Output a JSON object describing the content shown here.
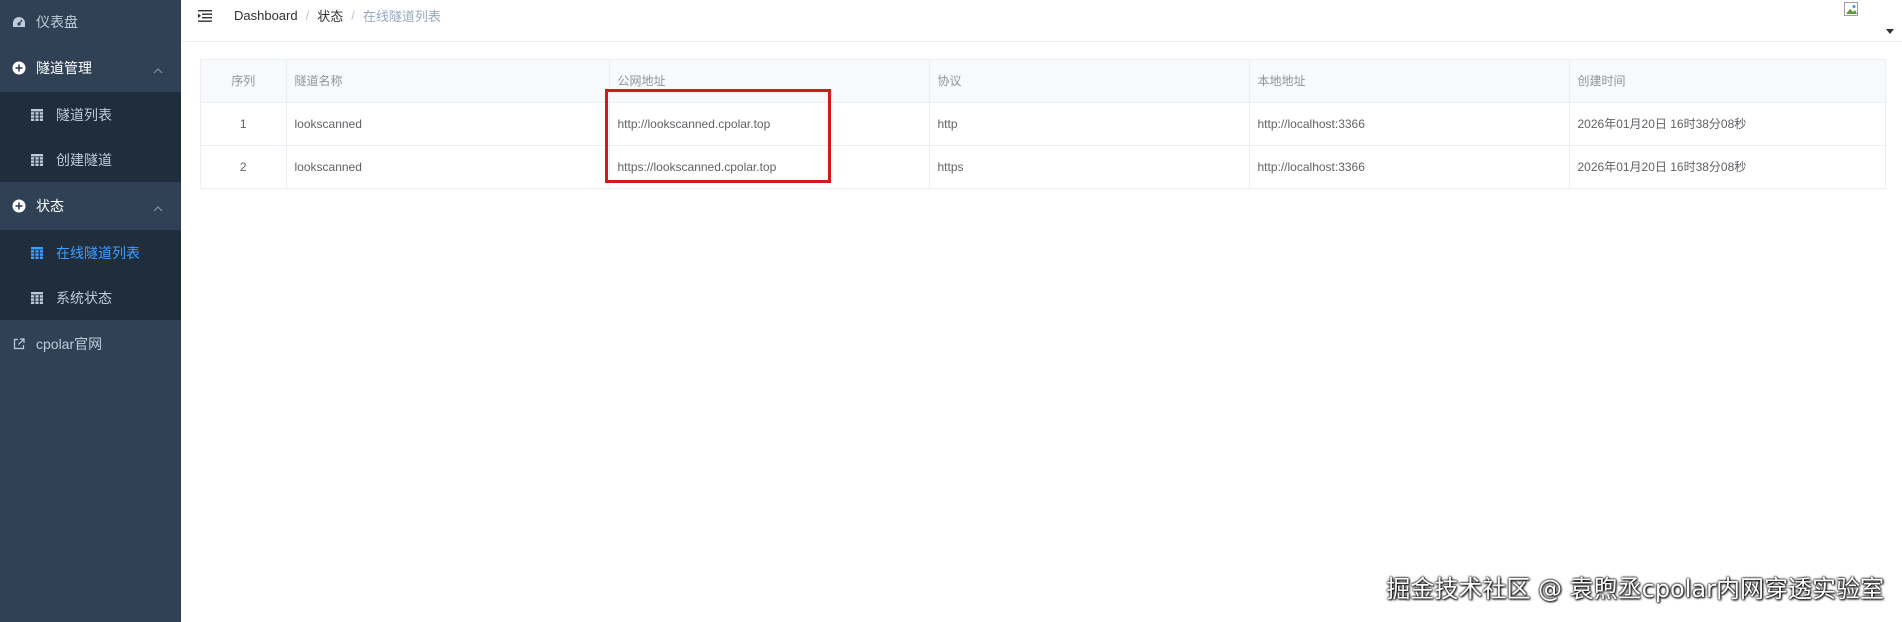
{
  "sidebar": {
    "dashboard": {
      "label": "仪表盘",
      "icon": "dashboard-icon"
    },
    "tunnel_mgmt": {
      "label": "隧道管理",
      "icon": "plus-circle-icon",
      "items": [
        {
          "label": "隧道列表",
          "icon": "table-icon"
        },
        {
          "label": "创建隧道",
          "icon": "table-icon"
        }
      ]
    },
    "status": {
      "label": "状态",
      "icon": "plus-circle-icon",
      "items": [
        {
          "label": "在线隧道列表",
          "icon": "table-icon",
          "active": true
        },
        {
          "label": "系统状态",
          "icon": "table-icon"
        }
      ]
    },
    "website": {
      "label": "cpolar官网",
      "icon": "external-link-icon"
    }
  },
  "breadcrumb": [
    "Dashboard",
    "状态",
    "在线隧道列表"
  ],
  "table": {
    "columns": [
      "序列",
      "隧道名称",
      "公网地址",
      "协议",
      "本地地址",
      "创建时间"
    ],
    "rows": [
      [
        "1",
        "lookscanned",
        "http://lookscanned.cpolar.top",
        "http",
        "http://localhost:3366",
        "2026年01月20日 16时38分08秒"
      ],
      [
        "2",
        "lookscanned",
        "https://lookscanned.cpolar.top",
        "https",
        "http://localhost:3366",
        "2026年01月20日 16时38分08秒"
      ]
    ]
  },
  "watermark": "掘金技术社区 @ 袁煦丞cpolar内网穿透实验室",
  "colors": {
    "sidebar_bg": "#304156",
    "submenu_bg": "#1f2d3d",
    "active": "#409eff",
    "highlight": "#d11a1a"
  }
}
